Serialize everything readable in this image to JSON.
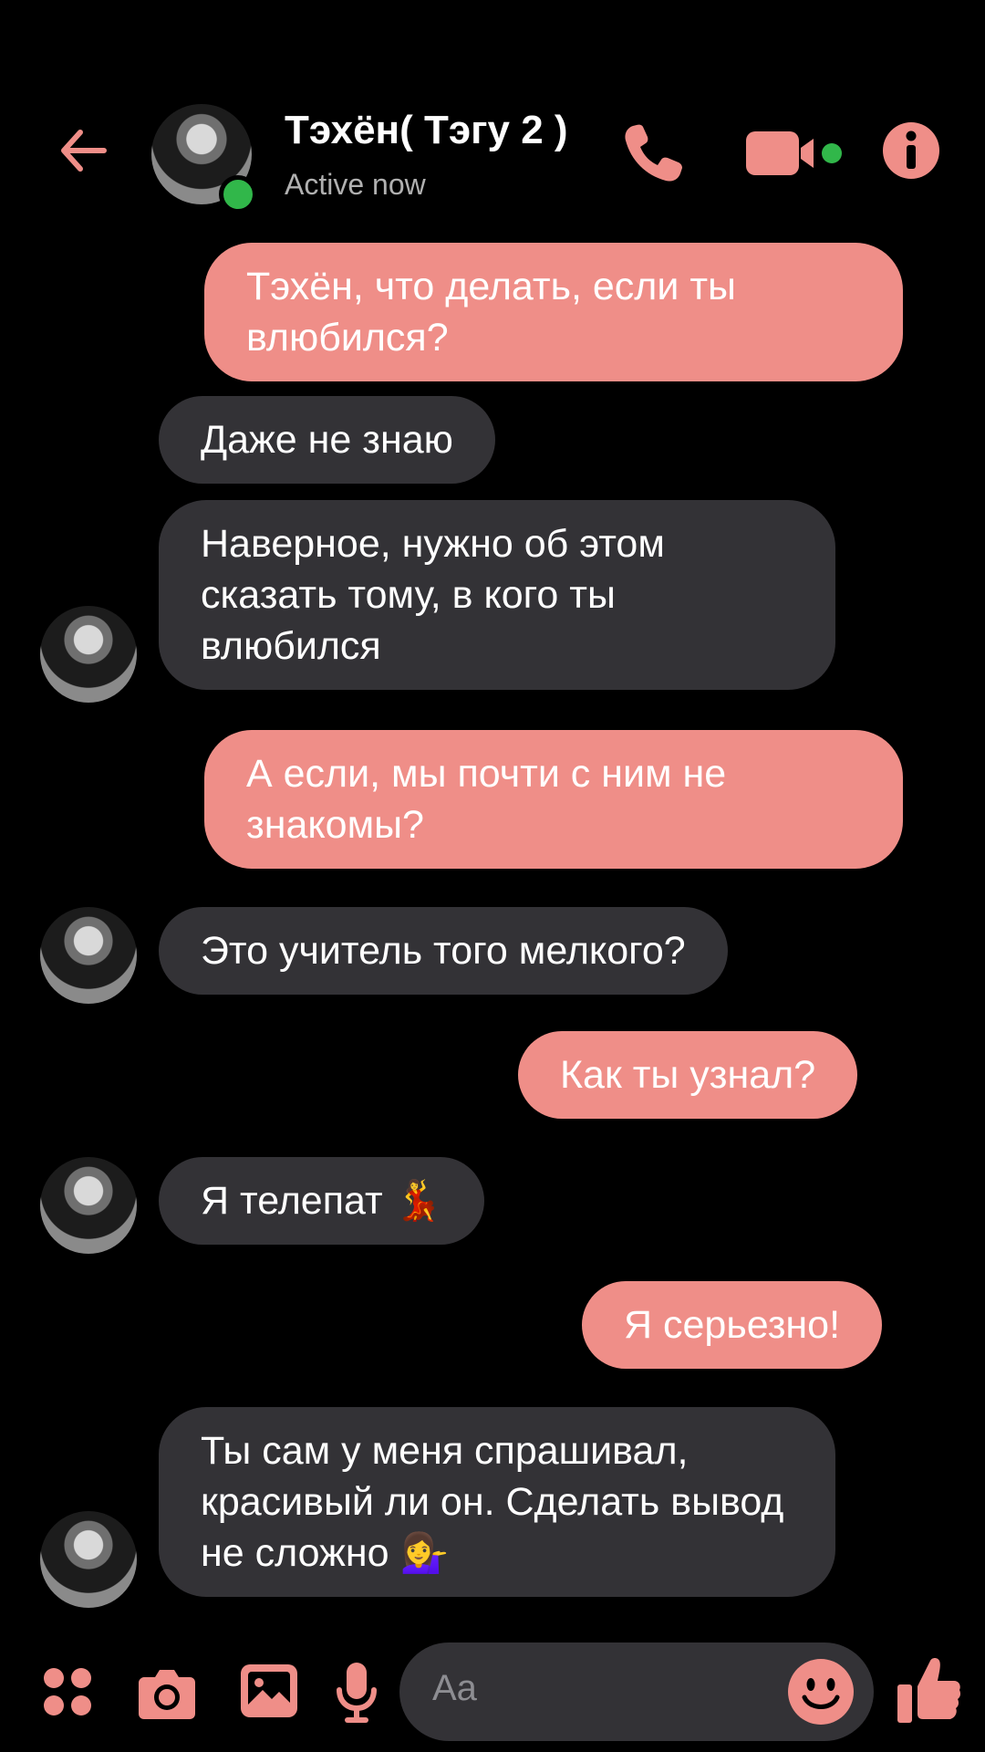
{
  "header": {
    "contact_name": "Тэхён( Тэгу 2 )",
    "status": "Active now"
  },
  "messages": [
    {
      "side": "out",
      "text": "Тэхён, что делать, если ты влюбился?"
    },
    {
      "side": "in",
      "text": "Даже не знаю"
    },
    {
      "side": "in",
      "text": "Наверное, нужно об этом сказать тому, в кого ты влюбился"
    },
    {
      "side": "out",
      "text": "А если, мы почти с ним не знакомы?"
    },
    {
      "side": "in",
      "text": "Это учитель того мелкого?"
    },
    {
      "side": "out",
      "text": "Как ты узнал?"
    },
    {
      "side": "in",
      "text": "Я телепат 💃"
    },
    {
      "side": "out",
      "text": "Я серьезно!"
    },
    {
      "side": "in",
      "text": "Ты сам у меня спрашивал, красивый ли он. Сделать вывод не сложно 💁‍♀️"
    }
  ],
  "composer": {
    "placeholder": "Aa"
  },
  "colors": {
    "accent": "#ef8e88",
    "incoming_bubble": "#333236",
    "background": "#000000",
    "active_dot": "#31b74a"
  }
}
